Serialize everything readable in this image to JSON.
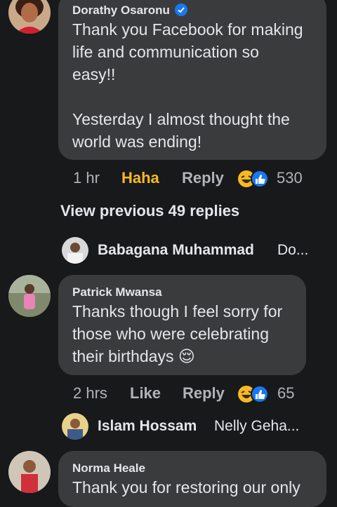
{
  "comment1": {
    "author": "Dorathy Osaronu",
    "text_line1": "Thank you Facebook for making",
    "text_line2": "life and communication so",
    "text_line3": "easy!!",
    "text_line4": "Yesterday I almost thought the",
    "text_line5": "world was ending!",
    "time": "1 hr",
    "reaction_label": "Haha",
    "reply_label": "Reply",
    "reaction_count": "530",
    "verified": true
  },
  "view_previous": "View previous 49 replies",
  "reply_preview1": {
    "name": "Babagana Muhammad",
    "snippet": "Do..."
  },
  "comment2": {
    "author": "Patrick Mwansa",
    "text_line1": "Thanks though I feel sorry for",
    "text_line2": "those who were celebrating",
    "text_line3": "their birthdays",
    "emoji": "😌",
    "time": "2 hrs",
    "like_label": "Like",
    "reply_label": "Reply",
    "reaction_count": "65"
  },
  "reply_preview2": {
    "name": "Islam Hossam",
    "snippet": "Nelly Geha..."
  },
  "comment3": {
    "author": "Norma Heale",
    "text_line1": "Thank you for restoring our only"
  },
  "colors": {
    "background": "#18191a",
    "bubble": "#3a3b3c",
    "haha": "#f7b928",
    "like_blue": "#1877f2"
  }
}
